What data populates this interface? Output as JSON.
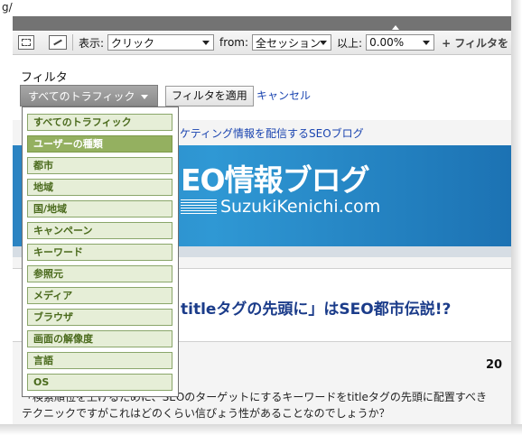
{
  "browser": {
    "url_fragment": "g/"
  },
  "toolbar": {
    "display_label": "表示:",
    "display_value": "クリック",
    "from_label": "from:",
    "from_value": "全セッション",
    "threshold_label": "以上:",
    "threshold_value": "0.00%",
    "add_filter": "+ フィルタを"
  },
  "filter": {
    "label": "フィルタ",
    "traffic_value": "すべてのトラフィック",
    "apply_label": "フィルタを適用",
    "cancel_label": "キャンセル"
  },
  "dropdown": {
    "items": [
      "すべてのトラフィック",
      "ユーザーの種類",
      "都市",
      "地域",
      "国/地域",
      "キャンペーン",
      "キーワード",
      "参照元",
      "メディア",
      "ブラウザ",
      "画面の解像度",
      "言語",
      "OS"
    ],
    "selected": "ユーザーの種類"
  },
  "page": {
    "tagline": "ケティング情報を配信するSEOブログ",
    "banner_title": "EO情報ブログ",
    "banner_url": "SuzukiKenichi.com",
    "article_title": "titleタグの先頭に」はSEO都市伝説!?",
    "year": "20",
    "body_line1": "「検索順位を上げるために、SEOのターゲットにするキーワードをtitleタグの先頭に配置すべき",
    "body_line2": "テクニックですがこれはどのくらい信ぴょう性があることなのでしょうか？"
  }
}
